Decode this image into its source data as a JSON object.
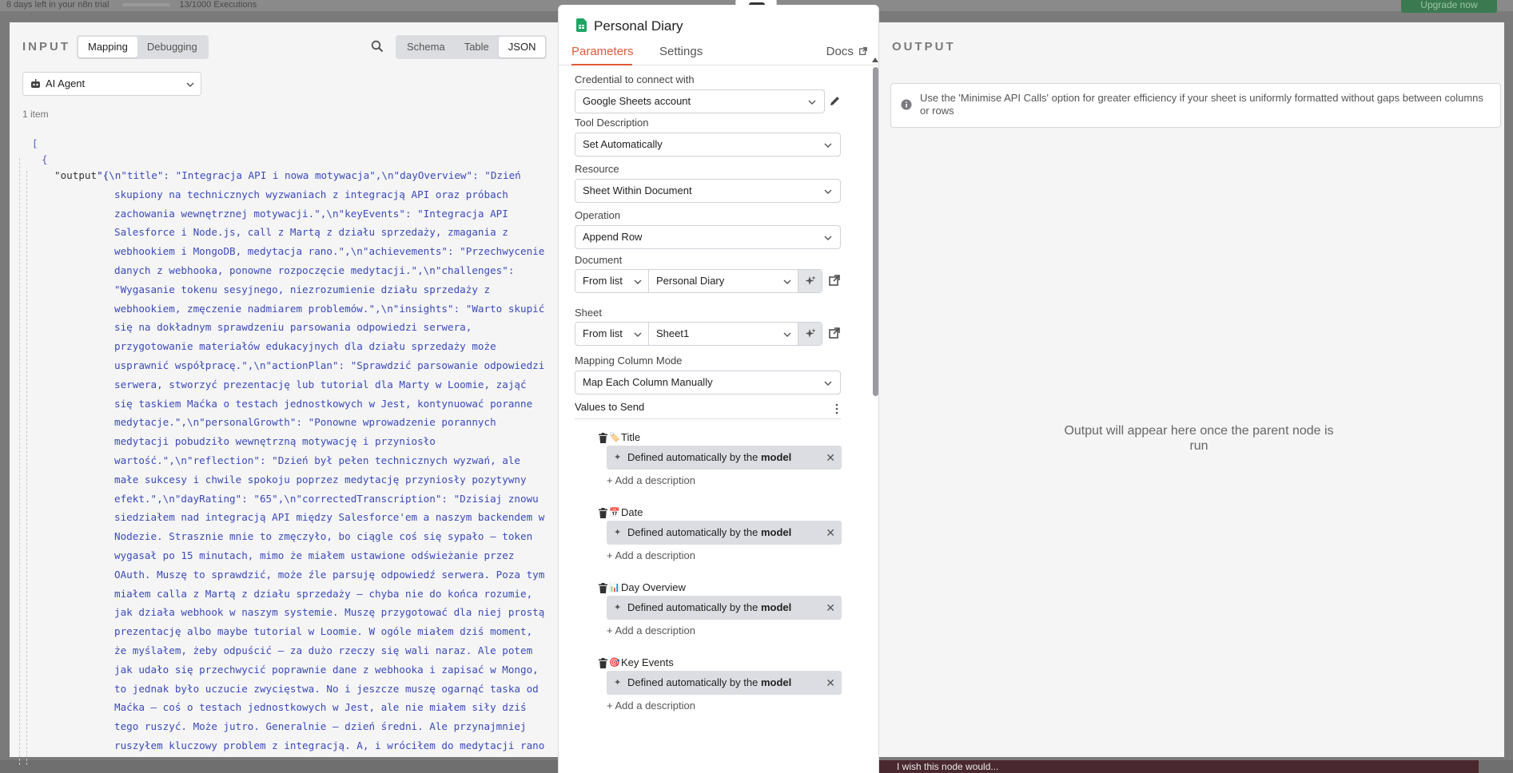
{
  "background": {
    "trial_text": "8 days left in your n8n trial",
    "executions_text": "13/1000 Executions",
    "upgrade_label": "Upgrade now",
    "wish_text": "I wish this node would..."
  },
  "input": {
    "title": "INPUT",
    "mode_options": [
      "Mapping",
      "Debugging"
    ],
    "view_options": [
      "Schema",
      "Table",
      "JSON"
    ],
    "source_node": "AI Agent",
    "item_count": "1 item",
    "json_open_bracket": "[",
    "json_open_brace": "{",
    "json_key": "\"output\":",
    "json_lines": [
      "\"{\\n\"title\": \"Integracja API i nowa motywacja\",\\n\"dayOverview\": \"Dzień",
      "skupiony na technicznych wyzwaniach z integracją API oraz próbach",
      "zachowania wewnętrznej motywacji.\",\\n\"keyEvents\": \"Integracja API",
      "Salesforce i Node.js, call z Martą z działu sprzedaży, zmagania z",
      "webhookiem i MongoDB, medytacja rano.\",\\n\"achievements\": \"Przechwycenie",
      "danych z webhooka, ponowne rozpoczęcie medytacji.\",\\n\"challenges\":",
      "\"Wygasanie tokenu sesyjnego, niezrozumienie działu sprzedaży z",
      "webhookiem, zmęczenie nadmiarem problemów.\",\\n\"insights\": \"Warto skupić",
      "się na dokładnym sprawdzeniu parsowania odpowiedzi serwera,",
      "przygotowanie materiałów edukacyjnych dla działu sprzedaży może",
      "usprawnić współpracę.\",\\n\"actionPlan\": \"Sprawdzić parsowanie odpowiedzi",
      "serwera, stworzyć prezentację lub tutorial dla Marty w Loomie, zająć",
      "się taskiem Maćka o testach jednostkowych w Jest, kontynuować poranne",
      "medytacje.\",\\n\"personalGrowth\": \"Ponowne wprowadzenie porannych",
      "medytacji pobudziło wewnętrzną motywację i przyniosło",
      "wartość.\",\\n\"reflection\": \"Dzień był pełen technicznych wyzwań, ale",
      "małe sukcesy i chwile spokoju poprzez medytację przyniosły pozytywny",
      "efekt.\",\\n\"dayRating\": \"65\",\\n\"correctedTranscription\": \"Dzisiaj znowu",
      "siedziałem nad integracją API między Salesforce'em a naszym backendem w",
      "Nodezie. Strasznie mnie to zmęczyło, bo ciągle coś się sypało – token",
      "wygasał po 15 minutach, mimo że miałem ustawione odświeżanie przez",
      "OAuth. Muszę to sprawdzić, może źle parsuję odpowiedź serwera. Poza tym",
      "miałem calla z Martą z działu sprzedaży – chyba nie do końca rozumie,",
      "jak działa webhook w naszym systemie. Muszę przygotować dla niej prostą",
      "prezentację albo maybe tutorial w Loomie. W ogóle miałem dziś moment,",
      "że myślałem, żeby odpuścić – za dużo rzeczy się wali naraz. Ale potem",
      "jak udało się przechwycić poprawnie dane z webhooka i zapisać w Mongo,",
      "to jednak było uczucie zwycięstwa. No i jeszcze muszę ogarnąć taska od",
      "Maćka – coś o testach jednostkowych w Jest, ale nie miałem siły dziś",
      "tego ruszyć. Może jutro. Generalnie – dzień średni. Ale przynajmniej",
      "ruszyłem kluczowy problem z integracją. A, i wróciłem do medytacji rano"
    ]
  },
  "node": {
    "title": "Personal Diary",
    "tabs": [
      "Parameters",
      "Settings"
    ],
    "docs_label": "Docs",
    "credential_label": "Credential to connect with",
    "credential_value": "Google Sheets account",
    "tool_description_label": "Tool Description",
    "tool_description_value": "Set Automatically",
    "resource_label": "Resource",
    "resource_value": "Sheet Within Document",
    "operation_label": "Operation",
    "operation_value": "Append Row",
    "document_label": "Document",
    "document_mode": "From list",
    "document_value": "Personal Diary",
    "sheet_label": "Sheet",
    "sheet_mode": "From list",
    "sheet_value": "Sheet1",
    "mapping_label": "Mapping Column Mode",
    "mapping_value": "Map Each Column Manually",
    "values_label": "Values to Send",
    "values": [
      {
        "emoji": "🏷️",
        "name": "Title",
        "pill_prefix": "Defined automatically by the",
        "pill_bold": "model",
        "add": "+ Add a description"
      },
      {
        "emoji": "📅",
        "name": "Date",
        "pill_prefix": "Defined automatically by the",
        "pill_bold": "model",
        "add": "+ Add a description"
      },
      {
        "emoji": "📊",
        "name": "Day Overview",
        "pill_prefix": "Defined automatically by the",
        "pill_bold": "model",
        "add": "+ Add a description"
      },
      {
        "emoji": "🎯",
        "name": "Key Events",
        "pill_prefix": "Defined automatically by the",
        "pill_bold": "model",
        "add": "+ Add a description"
      }
    ]
  },
  "output": {
    "title": "OUTPUT",
    "notice": "Use the 'Minimise API Calls' option for greater efficiency if your sheet is uniformly formatted without gaps between columns or rows",
    "empty_message": "Output will appear here once the parent node is run"
  }
}
